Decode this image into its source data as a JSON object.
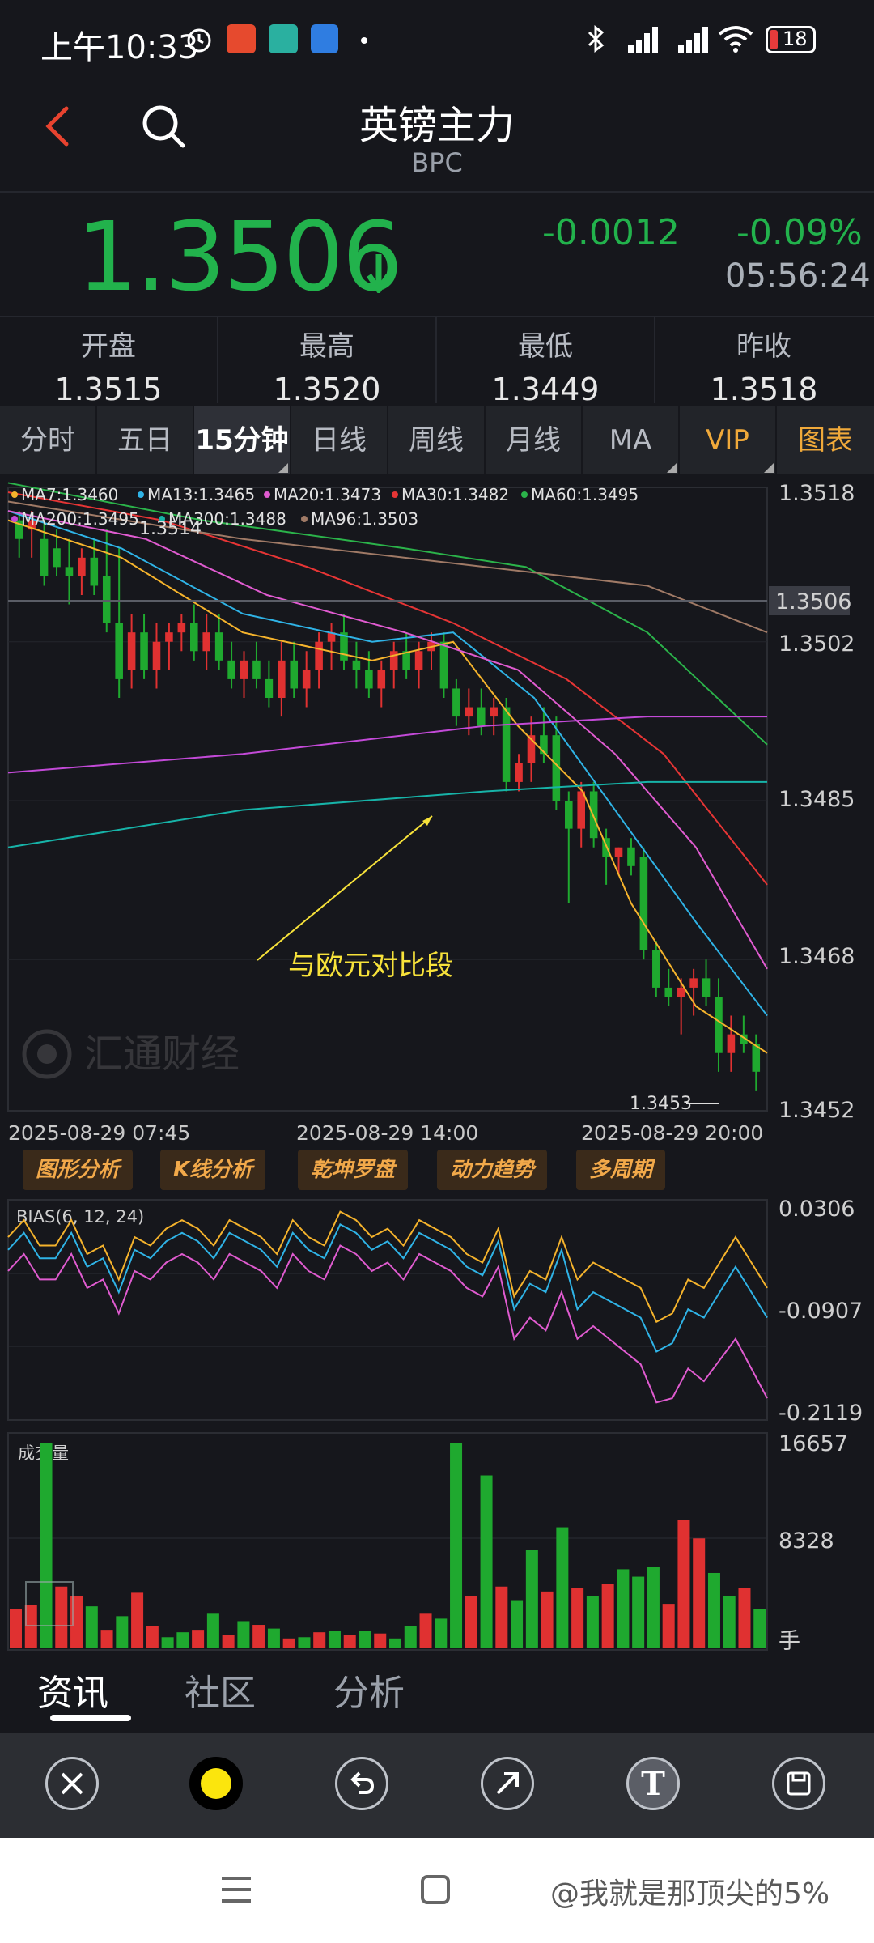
{
  "status_bar": {
    "time": "上午10:33",
    "battery": "18"
  },
  "header": {
    "title": "英镑主力",
    "subtitle": "BPC"
  },
  "quote": {
    "price": "1.3506",
    "change": "-0.0012",
    "change_pct": "-0.09%",
    "time": "05:56:24"
  },
  "stats": [
    {
      "label": "开盘",
      "value": "1.3515"
    },
    {
      "label": "最高",
      "value": "1.3520"
    },
    {
      "label": "最低",
      "value": "1.3449"
    },
    {
      "label": "昨收",
      "value": "1.3518"
    }
  ],
  "tabs": [
    "分时",
    "五日",
    "15分钟",
    "日线",
    "周线",
    "月线",
    "MA",
    "VIP",
    "图表"
  ],
  "active_tab": "15分钟",
  "main_chart": {
    "legend": [
      {
        "text": "MA7:1.3460",
        "color": "#f5b32c"
      },
      {
        "text": "MA13:1.3465",
        "color": "#2fb3e6"
      },
      {
        "text": "MA20:1.3473",
        "color": "#e05bd0"
      },
      {
        "text": "MA30:1.3482",
        "color": "#e63535"
      },
      {
        "text": "MA60:1.3495",
        "color": "#2bb34a"
      },
      {
        "text": "MA200:1.3495",
        "color": "#c34ad8"
      },
      {
        "text": "MA300:1.3488",
        "color": "#17b3a8"
      },
      {
        "text": "MA96:1.3503",
        "color": "#a07a66"
      }
    ],
    "y_labels": [
      "1.3518",
      "1.3502",
      "1.3485",
      "1.3468",
      "1.3452"
    ],
    "current_price": "1.3506",
    "high_mark": "1.3514",
    "low_mark": "1.3453",
    "x_labels": [
      "2025-08-29 07:45",
      "2025-08-29 14:00",
      "2025-08-29 20:00"
    ],
    "annotation": "与欧元对比段",
    "watermark": "汇通财经",
    "colors": {
      "up": "#e03131",
      "down": "#1fa92f",
      "annotation": "#f7e23a"
    }
  },
  "tools": [
    "图形分析",
    "K线分析",
    "乾坤罗盘",
    "动力趋势",
    "多周期"
  ],
  "bias_chart": {
    "title": "BIAS(6, 12, 24)",
    "y_labels": [
      "0.0306",
      "-0.0907",
      "-0.2119"
    ]
  },
  "volume_chart": {
    "title": "成交量",
    "y_labels": [
      "16657",
      "8328",
      "手"
    ]
  },
  "bottom_tabs": [
    "资讯",
    "社区",
    "分析"
  ],
  "draw_tools": [
    "close-icon",
    "color-icon",
    "undo-icon",
    "arrow-icon",
    "text-icon",
    "save-icon"
  ],
  "watermark_user": "@我就是那顶尖的5%"
}
